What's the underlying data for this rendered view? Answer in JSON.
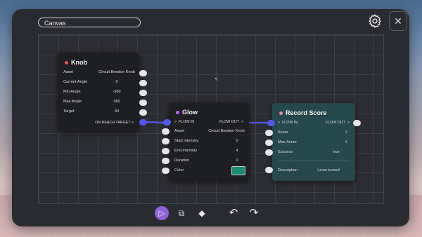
{
  "panel": {
    "title": "Canvas",
    "close_label": "✕"
  },
  "nodes": {
    "knob": {
      "title": "Knob",
      "dot_color": "#e85555",
      "rows": [
        {
          "label": "Asset",
          "value": "Circuit Breaker Knob"
        },
        {
          "label": "Current Angle",
          "value": "0"
        },
        {
          "label": "Min Angle",
          "value": "-360"
        },
        {
          "label": "Max Angle",
          "value": "360"
        },
        {
          "label": "Target",
          "value": "90"
        }
      ],
      "flow_out": "ON REACH TARGET"
    },
    "glow": {
      "title": "Glow",
      "dot_color": "#b06cf0",
      "flow_in": "FLOW IN",
      "flow_out": "FLOW OUT",
      "rows": [
        {
          "label": "Asset",
          "value": "Circuit Breaker Knob"
        },
        {
          "label": "Start intensity",
          "value": "0"
        },
        {
          "label": "End intensity",
          "value": "4"
        },
        {
          "label": "Duration",
          "value": "0"
        },
        {
          "label": "Color",
          "value": ""
        }
      ],
      "color_value": "#1f8b72"
    },
    "record": {
      "title": "Record Score",
      "dot_color": "#e58fb0",
      "flow_in": "FLOW IN",
      "flow_out": "FLOW OUT",
      "rows": [
        {
          "label": "Score",
          "value": "1"
        },
        {
          "label": "Max Score",
          "value": "1"
        },
        {
          "label": "Success",
          "value": "true"
        }
      ],
      "description_label": "Description",
      "description_value": "Lever turned"
    }
  },
  "arrow": ">",
  "toolbar": {
    "select_icon": "▷",
    "duplicate_icon": "⧉",
    "erase_icon": "◆",
    "undo_icon": "↶",
    "redo_icon": "↷"
  },
  "colors": {
    "accent": "#8f62d6",
    "connector": "#5757e8",
    "teal_node": "#26474b"
  }
}
